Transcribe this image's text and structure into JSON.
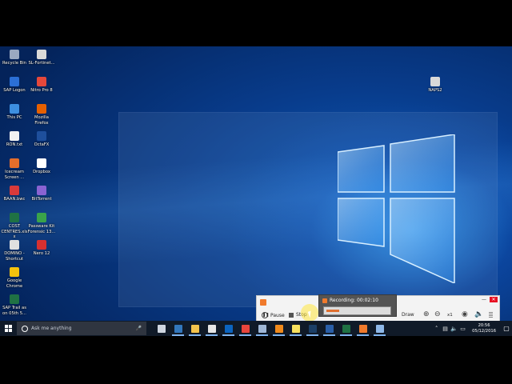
{
  "desktop": {
    "icons": [
      {
        "label": "Recycle Bin",
        "icon": "recycle-bin-icon",
        "color": "#9aa9c0"
      },
      {
        "label": "SL-Fortinet...",
        "icon": "fortinet-icon",
        "color": "#d9d9d9"
      },
      {
        "label": "SAP Logon",
        "icon": "sap-logon-icon",
        "color": "#2b6fd6"
      },
      {
        "label": "Nitro Pro 8",
        "icon": "nitro-icon",
        "color": "#e5483b"
      },
      {
        "label": "This PC",
        "icon": "this-pc-icon",
        "color": "#3d8fe0"
      },
      {
        "label": "Mozilla Firefox",
        "icon": "firefox-icon",
        "color": "#e66000"
      },
      {
        "label": "RON.txt",
        "icon": "text-file-icon",
        "color": "#f2f2f2"
      },
      {
        "label": "OctaFX",
        "icon": "octafx-icon",
        "color": "#1e4f9c"
      },
      {
        "label": "Icecream Screen ...",
        "icon": "icecream-icon",
        "color": "#e56e2b"
      },
      {
        "label": "Dropbox",
        "icon": "dropbox-icon",
        "color": "#ffffff"
      },
      {
        "label": "BAAN.bwc",
        "icon": "baan-icon",
        "color": "#d93a3a"
      },
      {
        "label": "BitTorrent",
        "icon": "bittorrent-icon",
        "color": "#8a63d2"
      },
      {
        "label": "COST CENTRES.xlsx",
        "icon": "excel-file-icon",
        "color": "#1f7244"
      },
      {
        "label": "Passware Kit Forensic 13...",
        "icon": "passware-icon",
        "color": "#3aa34a"
      },
      {
        "label": "DOMINO - Shortcut",
        "icon": "domino-icon",
        "color": "#e0e0e0"
      },
      {
        "label": "Nero 12",
        "icon": "nero-icon",
        "color": "#d63030"
      },
      {
        "label": "Google Chrome",
        "icon": "chrome-icon",
        "color": "#f4c20d"
      },
      {
        "label": "SAP Trail as on 05th 5...",
        "icon": "sap-trail-icon",
        "color": "#1f7244"
      },
      {
        "label": "NAPS2",
        "icon": "naps2-icon",
        "color": "#d9d9d9"
      }
    ]
  },
  "taskbar": {
    "search_placeholder": "Ask me anything",
    "apps": [
      {
        "name": "task-view",
        "color": "#cfd6e0"
      },
      {
        "name": "edge",
        "color": "#3277bc"
      },
      {
        "name": "file-explorer",
        "color": "#f3c34c"
      },
      {
        "name": "store",
        "color": "#e6e6e6"
      },
      {
        "name": "outlook",
        "color": "#0b64c0"
      },
      {
        "name": "chrome",
        "color": "#e8453c"
      },
      {
        "name": "file-manager",
        "color": "#9fb7d6"
      },
      {
        "name": "vlc",
        "color": "#f08a1c"
      },
      {
        "name": "sticky-notes",
        "color": "#f6e05e"
      },
      {
        "name": "photoshop",
        "color": "#1c3f66"
      },
      {
        "name": "octafx",
        "color": "#2a5fa8"
      },
      {
        "name": "excel",
        "color": "#1f7244"
      },
      {
        "name": "icecream-recorder",
        "color": "#f07a2c"
      },
      {
        "name": "snipping-tool",
        "color": "#8fb8e8"
      }
    ],
    "clock": {
      "time": "20:56",
      "date": "05/12/2016"
    }
  },
  "recorder": {
    "pause_label": "Pause",
    "stop_label": "Stop",
    "draw_label": "Draw",
    "zoom_level": "x1",
    "popup_title": "Recording: 00:02:10"
  }
}
